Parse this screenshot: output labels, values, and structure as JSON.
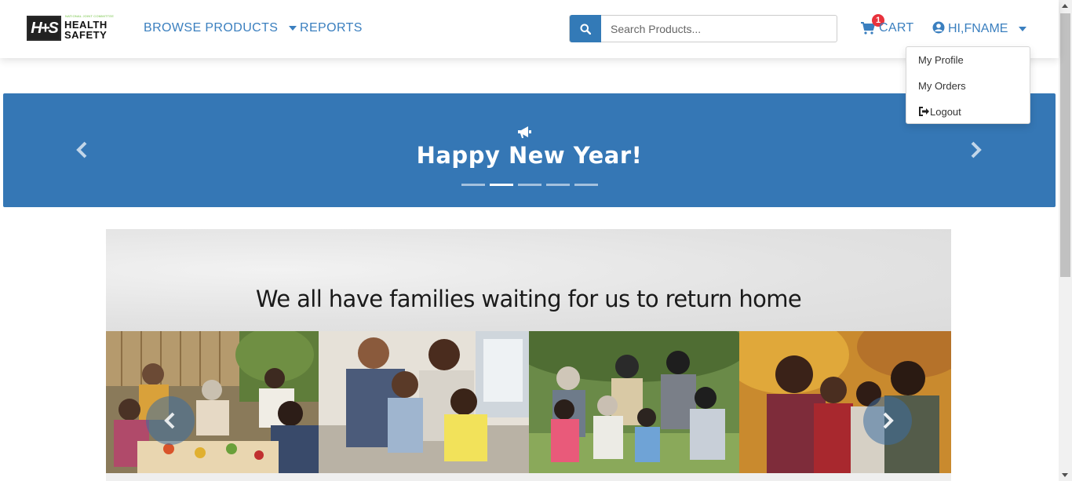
{
  "header": {
    "logo": {
      "badge": "H+S",
      "small_text": "NATIONAL JOINT COMMITTEE",
      "line1": "HEALTH",
      "line2": "SAFETY"
    },
    "nav": {
      "browse_products": "BROWSE PRODUCTS",
      "reports": "REPORTS"
    },
    "search": {
      "placeholder": "Search Products...",
      "value": ""
    },
    "cart": {
      "label": "CART",
      "count": "1"
    },
    "user": {
      "greeting": "HI,FNAME"
    }
  },
  "user_menu": {
    "items": [
      "My Profile",
      "My Orders",
      "Logout"
    ]
  },
  "banner": {
    "title": "Happy New Year!",
    "slide_count": 5,
    "active_slide": 2
  },
  "hero": {
    "tagline": "We all have families waiting for us to return home"
  },
  "colors": {
    "brand_blue": "#3577b5",
    "link_blue": "#3a7fbf",
    "badge_red": "#e8323c"
  }
}
